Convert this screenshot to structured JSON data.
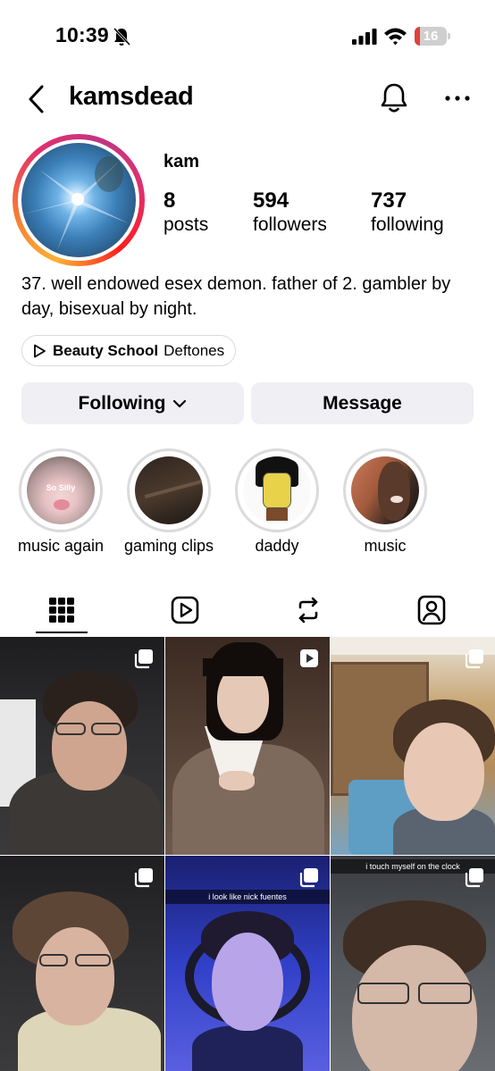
{
  "status_bar": {
    "time": "10:39",
    "battery": "16",
    "battery_level_percent": 16,
    "icons": [
      "bell-slash-icon",
      "cellular-signal-icon",
      "wifi-icon",
      "battery-icon"
    ]
  },
  "header": {
    "username": "kamsdead",
    "icons": [
      "chevron-left-icon",
      "bell-icon",
      "more-horizontal-icon"
    ]
  },
  "profile": {
    "display_name": "kam",
    "stats": [
      {
        "value": "8",
        "label": "posts"
      },
      {
        "value": "594",
        "label": "followers"
      },
      {
        "value": "737",
        "label": "following"
      }
    ],
    "bio": "37. well endowed esex demon. father of 2. gambler by day, bisexual by night.",
    "music": {
      "song": "Beauty School",
      "artist": "Deftones"
    }
  },
  "actions": {
    "following_label": "Following",
    "message_label": "Message"
  },
  "highlights": [
    {
      "label": "music again",
      "caption": "So Silly"
    },
    {
      "label": "gaming clips",
      "caption": ""
    },
    {
      "label": "daddy",
      "caption": ""
    },
    {
      "label": "music",
      "caption": ""
    }
  ],
  "tabs": [
    {
      "icon": "grid-icon",
      "active": true
    },
    {
      "icon": "reels-icon",
      "active": false
    },
    {
      "icon": "reposts-icon",
      "active": false
    },
    {
      "icon": "tagged-icon",
      "active": false
    }
  ],
  "posts": [
    {
      "badge": "multi-post-icon",
      "caption": ""
    },
    {
      "badge": "reel-icon",
      "caption": ""
    },
    {
      "badge": "multi-post-icon",
      "caption": ""
    },
    {
      "badge": "multi-post-icon",
      "caption": ""
    },
    {
      "badge": "multi-post-icon",
      "caption": "i look like nick fuentes"
    },
    {
      "badge": "multi-post-icon",
      "caption": "i touch myself on the clock"
    }
  ],
  "colors": {
    "button_bg": "#efeff4",
    "battery_low": "#e0413a",
    "ring_gradient": [
      "#f9b233",
      "#f77737",
      "#e1306c",
      "#c13584"
    ]
  }
}
